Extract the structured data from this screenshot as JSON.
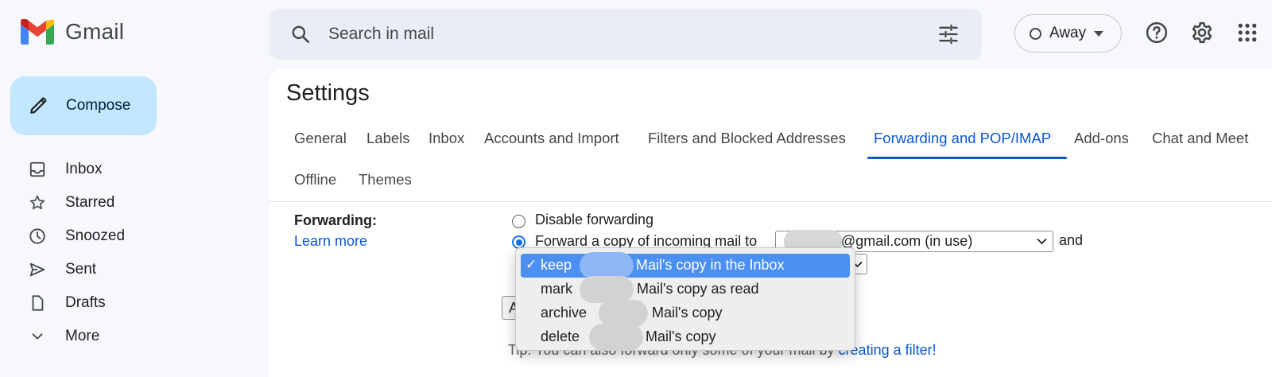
{
  "app": {
    "name": "Gmail",
    "brand_colors": [
      "#EA4335",
      "#4285F4",
      "#34A853",
      "#FBBC04",
      "#C5221F"
    ]
  },
  "search": {
    "placeholder": "Search in mail"
  },
  "status": {
    "label": "Away"
  },
  "icons": {
    "search": "search-icon",
    "tune": "tune-icon",
    "help": "help-icon",
    "settings": "gear-icon",
    "apps": "apps-grid-icon",
    "compose": "pencil-icon"
  },
  "compose": {
    "label": "Compose"
  },
  "nav": [
    {
      "label": "Inbox",
      "icon": "inbox-icon"
    },
    {
      "label": "Starred",
      "icon": "star-icon"
    },
    {
      "label": "Snoozed",
      "icon": "clock-icon"
    },
    {
      "label": "Sent",
      "icon": "send-icon"
    },
    {
      "label": "Drafts",
      "icon": "draft-icon"
    },
    {
      "label": "More",
      "icon": "chevron-down-icon"
    }
  ],
  "settings": {
    "title": "Settings",
    "tabs": [
      {
        "label": "General"
      },
      {
        "label": "Labels"
      },
      {
        "label": "Inbox"
      },
      {
        "label": "Accounts and Import"
      },
      {
        "label": "Filters and Blocked Addresses"
      },
      {
        "label": "Forwarding and POP/IMAP",
        "active": true
      },
      {
        "label": "Add-ons"
      },
      {
        "label": "Chat and Meet"
      },
      {
        "label": "Offline"
      },
      {
        "label": "Themes"
      }
    ],
    "forwarding": {
      "label": "Forwarding:",
      "learn_more": "Learn more",
      "disable_option": "Disable forwarding",
      "forward_option": "Forward a copy of incoming mail to",
      "selected_option": "forward",
      "address_value": "@gmail.com (in use)",
      "and": "and",
      "action_options": [
        {
          "prefix": "keep",
          "suffix": "Mail's copy in the Inbox",
          "selected": true
        },
        {
          "prefix": "mark",
          "suffix": "Mail's copy as read"
        },
        {
          "prefix": "archive",
          "suffix": "Mail's copy"
        },
        {
          "prefix": "delete",
          "suffix": "Mail's copy"
        }
      ],
      "check_mark": "✓",
      "behind_button": "A",
      "tip_prefix": "Tip: You can also forward only some of your mail by ",
      "tip_link": "creating a filter!"
    }
  },
  "colors": {
    "accent": "#0b57d0",
    "compose_bg": "#c2e7ff",
    "search_bg": "#e9eef6",
    "selected_option_bg": "#4b8ff0"
  }
}
